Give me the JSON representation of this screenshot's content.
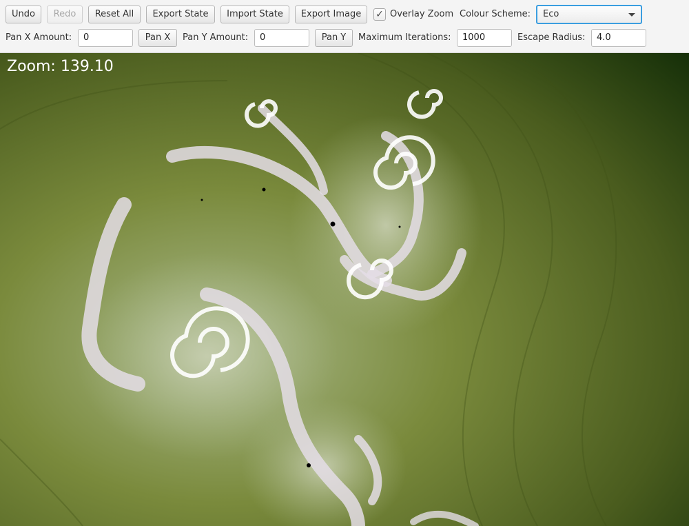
{
  "toolbar": {
    "undo_label": "Undo",
    "redo_label": "Redo",
    "reset_label": "Reset All",
    "export_state_label": "Export State",
    "import_state_label": "Import State",
    "export_image_label": "Export Image",
    "overlay_zoom_label": "Overlay Zoom",
    "overlay_zoom_checked": true,
    "colour_scheme_label": "Colour Scheme:",
    "colour_scheme_value": "Eco",
    "pan_x_label": "Pan X Amount:",
    "pan_x_value": "0",
    "pan_x_button": "Pan X",
    "pan_y_label": "Pan Y Amount:",
    "pan_y_value": "0",
    "pan_y_button": "Pan Y",
    "max_iter_label": "Maximum Iterations:",
    "max_iter_value": "1000",
    "escape_radius_label": "Escape Radius:",
    "escape_radius_value": "4.0"
  },
  "canvas": {
    "zoom_text": "Zoom: 139.10",
    "colors": {
      "dark": "#0f2a06",
      "mid": "#5e7028",
      "light": "#a9b88a",
      "fractal": "#e4dde6"
    }
  }
}
